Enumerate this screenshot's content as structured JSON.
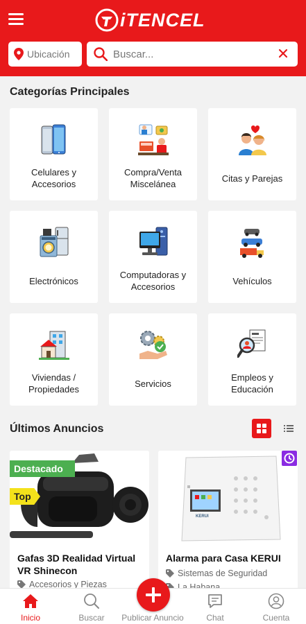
{
  "header": {
    "logo_text": "iTENCEL",
    "location_label": "Ubicación",
    "search_placeholder": "Buscar...",
    "brand_color": "#e8191b"
  },
  "categories_section": {
    "title": "Categorías Principales",
    "items": [
      {
        "label": "Celulares y Accesorios",
        "icon": "phone-icon"
      },
      {
        "label": "Compra/Venta Miscelánea",
        "icon": "shop-icon"
      },
      {
        "label": "Citas y Parejas",
        "icon": "couple-icon"
      },
      {
        "label": "Electrónicos",
        "icon": "appliances-icon"
      },
      {
        "label": "Computadoras y Accesorios",
        "icon": "computer-icon"
      },
      {
        "label": "Vehículos",
        "icon": "vehicles-icon"
      },
      {
        "label": "Viviendas / Propiedades",
        "icon": "house-icon"
      },
      {
        "label": "Servicios",
        "icon": "services-icon"
      },
      {
        "label": "Empleos y Educación",
        "icon": "jobs-icon"
      }
    ]
  },
  "latest_ads": {
    "title": "Últimos Anuncios",
    "ads": [
      {
        "title": "Gafas 3D Realidad Virtual VR Shinecon",
        "category": "Accesorios y Piezas",
        "badges": [
          "Destacado",
          "Top"
        ]
      },
      {
        "title": "Alarma para Casa KERUI",
        "category": "Sistemas de Seguridad",
        "location": "La Habana",
        "device_brand": "KERUI"
      }
    ]
  },
  "bottom_nav": {
    "home": "Inicio",
    "search": "Buscar",
    "publish": "Publicar Anuncio",
    "chat": "Chat",
    "account": "Cuenta"
  }
}
